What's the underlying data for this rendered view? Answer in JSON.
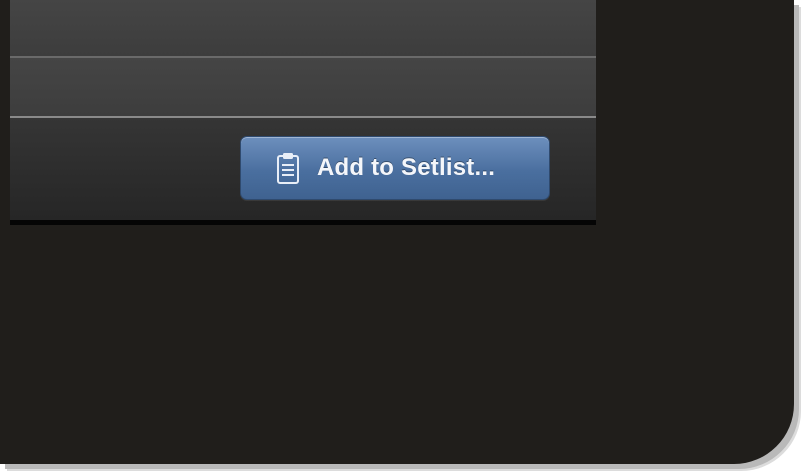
{
  "toolbar": {
    "add_to_setlist_label": "Add to Setlist...",
    "add_to_setlist_icon": "clipboard-icon"
  },
  "colors": {
    "bezel": "#201e1b",
    "screen_row": "#424242",
    "button_top": "#6d8fbd",
    "button_bottom": "#3f6290",
    "button_text": "#f4f6fa"
  }
}
